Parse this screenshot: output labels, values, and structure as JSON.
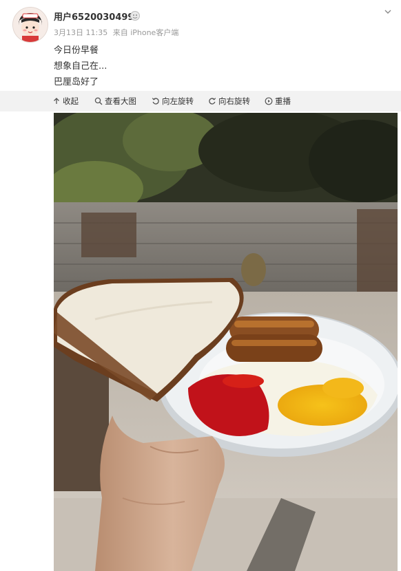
{
  "post": {
    "username": "用户6520030499",
    "date": "3月13日 11:35",
    "source": "来自 iPhone客户端",
    "lines": [
      "今日份早餐",
      "想象自己在...",
      "巴厘岛好了"
    ]
  },
  "toolbar": {
    "collapse": "收起",
    "view_large": "查看大图",
    "rotate_left": "向左旋转",
    "rotate_right": "向右旋转",
    "replay": "重播"
  },
  "icons": {
    "avatar": "avatar",
    "vip": "vip-icon",
    "expand": "expand-chevron-icon",
    "collapse": "arrow-up-icon",
    "view_large": "magnifier-icon",
    "rotate_left": "rotate-left-icon",
    "rotate_right": "rotate-right-icon",
    "replay": "play-circle-icon"
  },
  "colors": {
    "toolbar_bg": "#f2f2f2",
    "meta_text": "#999999",
    "text": "#333333"
  }
}
